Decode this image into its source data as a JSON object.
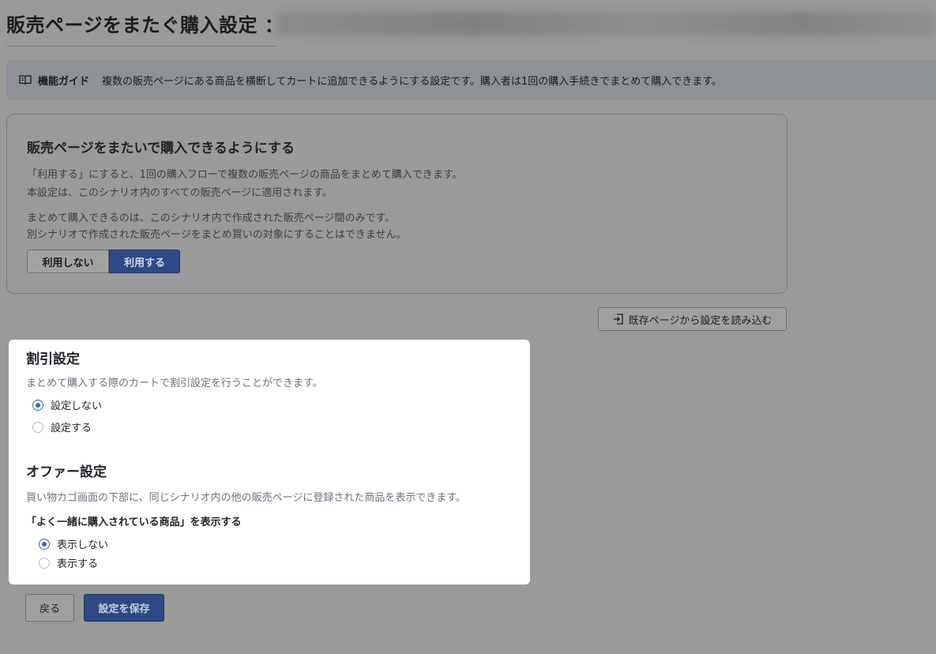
{
  "header": {
    "title": "販売ページをまたぐ購入設定 ："
  },
  "guide": {
    "icon": "book-open-icon",
    "label": "機能ガイド",
    "text": "複数の販売ページにある商品を横断してカートに追加できるようにする設定です。購入者は1回の購入手続きでまとめて購入できます。"
  },
  "cross_purchase": {
    "heading": "販売ページをまたいで購入できるようにする",
    "desc1": "「利用する」にすると、1回の購入フローで複数の販売ページの商品をまとめて購入できます。",
    "desc2": "本設定は、このシナリオ内のすべての販売ページに適用されます。",
    "desc3": "まとめて購入できるのは、このシナリオ内で作成された販売ページ間のみです。",
    "desc4": "別シナリオで作成された販売ページをまとめ買いの対象にすることはできません。",
    "option_off": "利用しない",
    "option_on": "利用する",
    "selected": "利用する"
  },
  "load_button": {
    "icon": "import-icon",
    "label": "既存ページから設定を読み込む"
  },
  "discount": {
    "heading": "割引設定",
    "desc": "まとめて購入する際のカートで割引設定を行うことができます。",
    "options": [
      "設定しない",
      "設定する"
    ],
    "selected": "設定しない"
  },
  "offer": {
    "heading": "オファー設定",
    "desc": "買い物カゴ画面の下部に、同じシナリオ内の他の販売ページに登録された商品を表示できます。",
    "sub_label": "「よく一緒に購入されている商品」を表示する",
    "options": [
      "表示しない",
      "表示する"
    ],
    "selected": "表示しない"
  },
  "footer": {
    "back_label": "戻る",
    "save_label": "設定を保存"
  },
  "colors": {
    "primary": "#2e4a86",
    "radio_checked": "#3a64b8",
    "overlay_bg": "#9a9a9a"
  }
}
